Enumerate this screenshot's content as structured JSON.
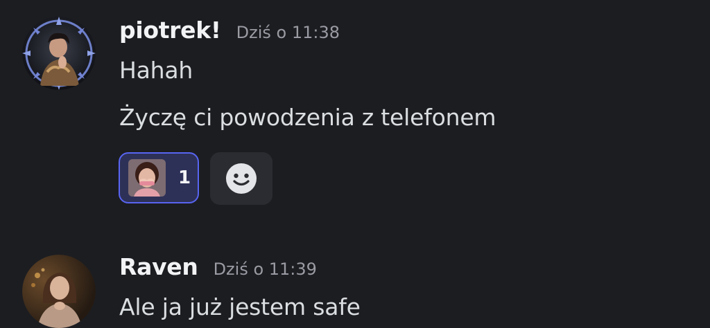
{
  "messages": [
    {
      "username": "piotrek!",
      "timestamp": "Dziś o 11:38",
      "lines": [
        "Hahah",
        "Życzę ci powodzenia z telefonem"
      ],
      "reactions": [
        {
          "count": "1"
        }
      ],
      "add_reaction_icon": "smiley-icon"
    },
    {
      "username": "Raven",
      "timestamp": "Dziś o 11:39",
      "lines": [
        "Ale ja już jestem safe"
      ]
    }
  ],
  "colors": {
    "background": "#1c1d21",
    "reaction_border": "#5865f2",
    "reaction_bg": "#2e3157",
    "username": "#f2f3f5",
    "timestamp": "#9a9ba3"
  }
}
